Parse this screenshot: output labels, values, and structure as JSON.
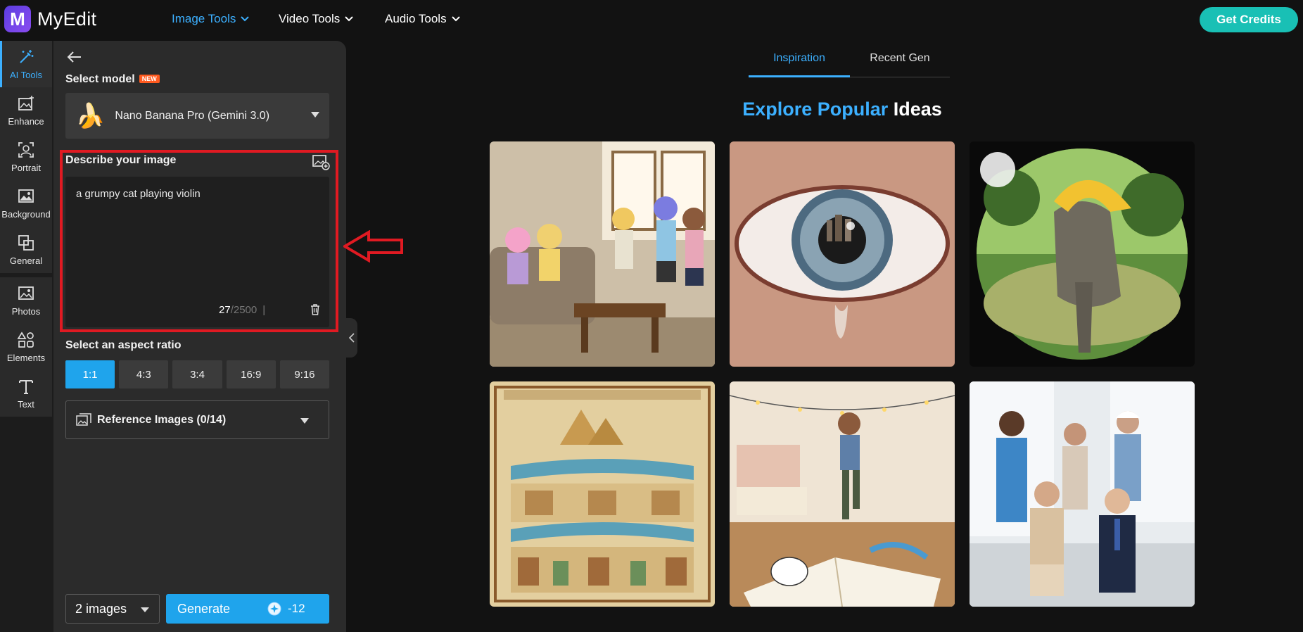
{
  "header": {
    "logo_letter": "M",
    "app_name": "MyEdit",
    "nav": [
      {
        "label": "Image Tools"
      },
      {
        "label": "Video Tools"
      },
      {
        "label": "Audio Tools"
      }
    ],
    "credits_label": "Get Credits"
  },
  "rail": {
    "items": [
      {
        "label": "AI Tools",
        "icon": "magic-wand-icon"
      },
      {
        "label": "Enhance",
        "icon": "enhance-icon"
      },
      {
        "label": "Portrait",
        "icon": "portrait-icon"
      },
      {
        "label": "Background",
        "icon": "background-icon"
      },
      {
        "label": "General",
        "icon": "general-icon"
      },
      {
        "label": "Photos",
        "icon": "photos-icon"
      },
      {
        "label": "Elements",
        "icon": "elements-icon"
      },
      {
        "label": "Text",
        "icon": "text-icon"
      }
    ],
    "plus": "+"
  },
  "panel": {
    "select_model_label": "Select model",
    "new_badge": "NEW",
    "model_name": "Nano Banana Pro (Gemini 3.0)",
    "model_emoji": "🍌",
    "describe_label": "Describe your image",
    "prompt_value": "a grumpy cat playing violin",
    "char_count": "27",
    "char_max": "/2500",
    "separator": "|",
    "aspect_label": "Select an aspect ratio",
    "ratios": [
      "1:1",
      "4:3",
      "3:4",
      "16:9",
      "9:16"
    ],
    "selected_ratio": "1:1",
    "reference_label": "Reference Images (0/14)",
    "image_count": "2 images",
    "generate_label": "Generate",
    "generate_cost": "-12"
  },
  "main": {
    "tabs": [
      {
        "label": "Inspiration"
      },
      {
        "label": "Recent Gen"
      }
    ],
    "active_tab": "Inspiration",
    "headline_part1": "Explore Popular",
    "headline_part2": " Ideas"
  },
  "colors": {
    "accent": "#3cb0ff",
    "primary_button": "#1fa4ec",
    "credits_button": "#19c0b5",
    "highlight_box": "#e01a22"
  }
}
